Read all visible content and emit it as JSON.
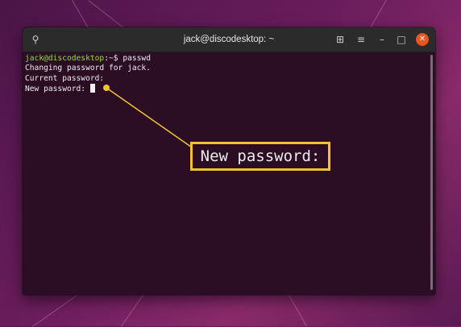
{
  "window": {
    "title": "jack@discodesktop: ~",
    "buttons": {
      "search_icon": "⚲",
      "new_tab_icon": "⊞",
      "menu_icon": "≡",
      "minimize_icon": "–",
      "maximize_icon": "□",
      "close_icon": "✕"
    }
  },
  "terminal": {
    "prompt_user": "jack@discodesktop",
    "prompt_suffix": ":~$ ",
    "command": "passwd",
    "line2": "Changing password for jack.",
    "line3": "Current password:",
    "line4": "New password: "
  },
  "callout": {
    "text": "New password:",
    "color": "#f2c230"
  }
}
